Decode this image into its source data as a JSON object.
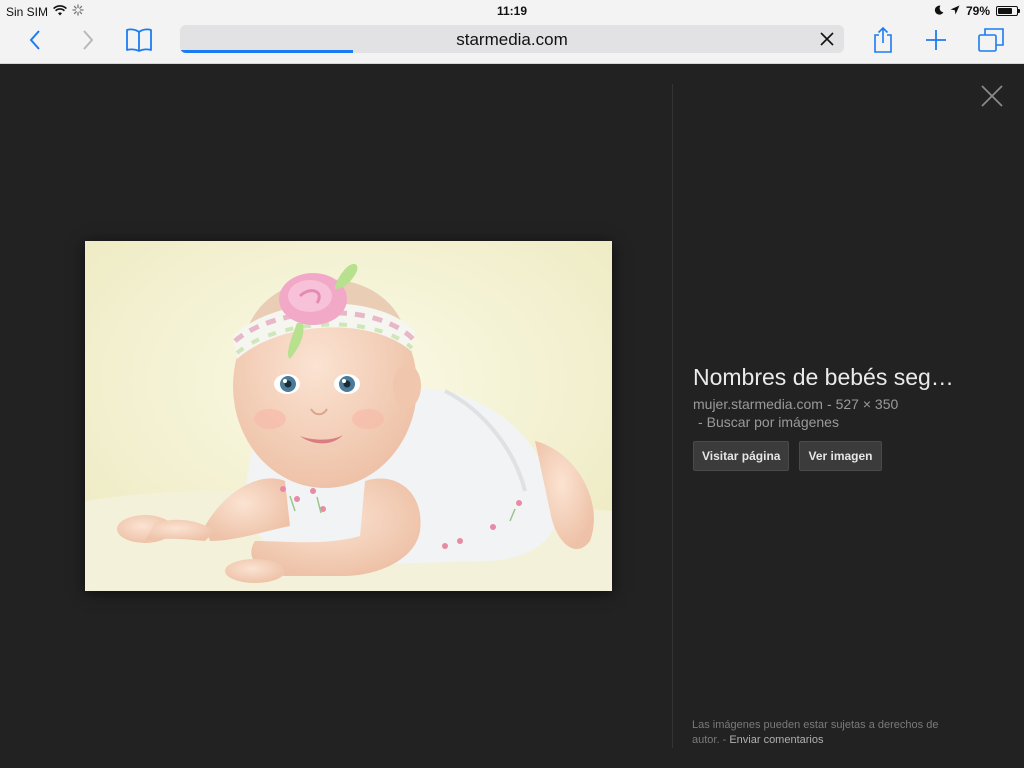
{
  "status_bar": {
    "carrier": "Sin SIM",
    "time": "11:19",
    "battery": "79%",
    "battery_level": 0.79
  },
  "toolbar": {
    "url": "starmedia.com",
    "load_progress": 0.26,
    "icons": [
      "back-chevron-icon",
      "forward-chevron-icon",
      "bookmarks-icon",
      "clear-icon",
      "share-icon",
      "new-tab-icon",
      "tabs-icon"
    ]
  },
  "viewer": {
    "title": "Nombres de bebés seg…",
    "source": "mujer.starmedia.com",
    "dimensions": "527 × 350",
    "search_by_image": "Buscar por imágenes",
    "visit_button": "Visitar página",
    "view_button": "Ver imagen",
    "footer_text": "Las imágenes pueden estar sujetas a derechos de autor.",
    "footer_link": "Enviar comentarios"
  },
  "colors": {
    "accent": "#1b7cf2",
    "viewer_bg": "#222222",
    "chrome_bg": "#f3f3f3"
  }
}
